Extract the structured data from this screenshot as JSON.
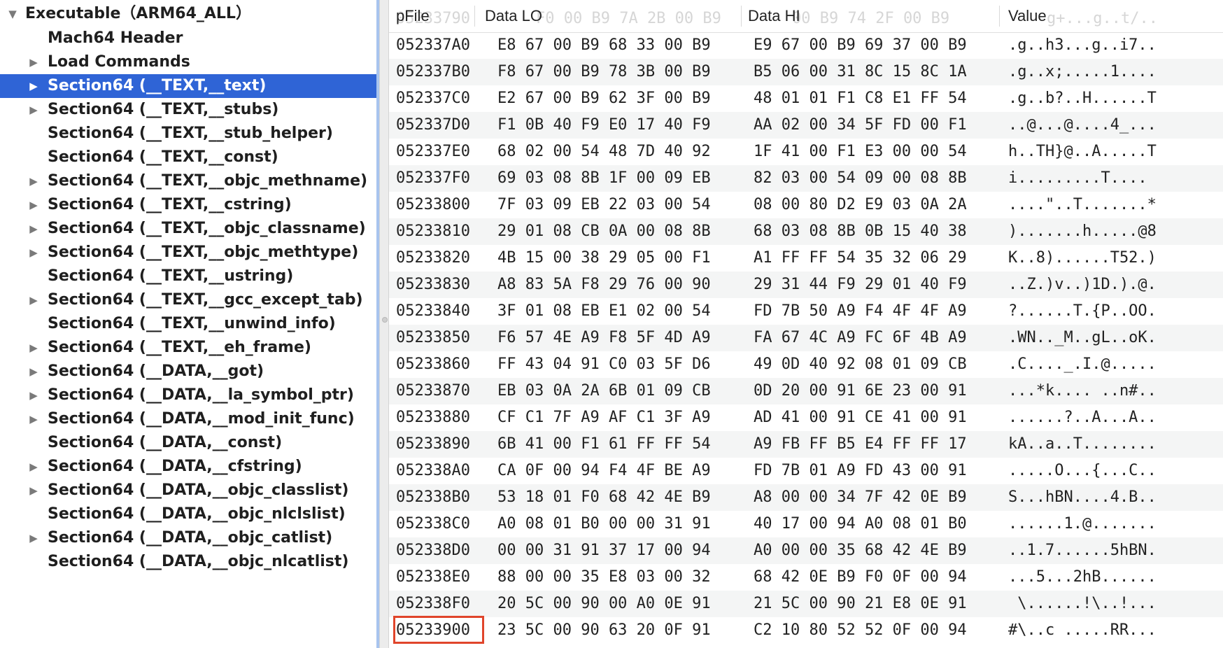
{
  "tree": {
    "root_label": "Executable（ARM64_ALL）",
    "items": [
      {
        "label": "Mach64 Header",
        "expandable": false,
        "selected": false
      },
      {
        "label": "Load Commands",
        "expandable": true,
        "selected": false
      },
      {
        "label": "Section64 (__TEXT,__text)",
        "expandable": true,
        "selected": true
      },
      {
        "label": "Section64 (__TEXT,__stubs)",
        "expandable": true,
        "selected": false
      },
      {
        "label": "Section64 (__TEXT,__stub_helper)",
        "expandable": false,
        "selected": false
      },
      {
        "label": "Section64 (__TEXT,__const)",
        "expandable": false,
        "selected": false
      },
      {
        "label": "Section64 (__TEXT,__objc_methname)",
        "expandable": true,
        "selected": false
      },
      {
        "label": "Section64 (__TEXT,__cstring)",
        "expandable": true,
        "selected": false
      },
      {
        "label": "Section64 (__TEXT,__objc_classname)",
        "expandable": true,
        "selected": false
      },
      {
        "label": "Section64 (__TEXT,__objc_methtype)",
        "expandable": true,
        "selected": false
      },
      {
        "label": "Section64 (__TEXT,__ustring)",
        "expandable": false,
        "selected": false
      },
      {
        "label": "Section64 (__TEXT,__gcc_except_tab)",
        "expandable": true,
        "selected": false
      },
      {
        "label": "Section64 (__TEXT,__unwind_info)",
        "expandable": false,
        "selected": false
      },
      {
        "label": "Section64 (__TEXT,__eh_frame)",
        "expandable": true,
        "selected": false
      },
      {
        "label": "Section64 (__DATA,__got)",
        "expandable": true,
        "selected": false
      },
      {
        "label": "Section64 (__DATA,__la_symbol_ptr)",
        "expandable": true,
        "selected": false
      },
      {
        "label": "Section64 (__DATA,__mod_init_func)",
        "expandable": true,
        "selected": false
      },
      {
        "label": "Section64 (__DATA,__const)",
        "expandable": false,
        "selected": false
      },
      {
        "label": "Section64 (__DATA,__cfstring)",
        "expandable": true,
        "selected": false
      },
      {
        "label": "Section64 (__DATA,__objc_classlist)",
        "expandable": true,
        "selected": false
      },
      {
        "label": "Section64 (__DATA,__objc_nlclslist)",
        "expandable": false,
        "selected": false
      },
      {
        "label": "Section64 (__DATA,__objc_catlist)",
        "expandable": true,
        "selected": false
      },
      {
        "label": "Section64 (__DATA,__objc_nlcatlist)",
        "expandable": false,
        "selected": false
      }
    ]
  },
  "table": {
    "headers": [
      "pFile",
      "Data LO",
      "Data HI",
      "Value"
    ],
    "ghost_row": {
      "offset": "05233790",
      "lo": "F0 00 B9 7A 2B 00 B9",
      "hi": "00 B9 74 2F 00 B9",
      "value": "g+...g..t/.."
    },
    "rows": [
      {
        "offset": "052337A0",
        "lo": "E8 67 00 B9 68 33 00 B9",
        "hi": "E9 67 00 B9 69 37 00 B9",
        "value": ".g..h3...g..i7.."
      },
      {
        "offset": "052337B0",
        "lo": "F8 67 00 B9 78 3B 00 B9",
        "hi": "B5 06 00 31 8C 15 8C 1A",
        "value": ".g..x;.....1...."
      },
      {
        "offset": "052337C0",
        "lo": "E2 67 00 B9 62 3F 00 B9",
        "hi": "48 01 01 F1 C8 E1 FF 54",
        "value": ".g..b?..H......T"
      },
      {
        "offset": "052337D0",
        "lo": "F1 0B 40 F9 E0 17 40 F9",
        "hi": "AA 02 00 34 5F FD 00 F1",
        "value": "..@...@....4_..."
      },
      {
        "offset": "052337E0",
        "lo": "68 02 00 54 48 7D 40 92",
        "hi": "1F 41 00 F1 E3 00 00 54",
        "value": "h..TH}@..A.....T"
      },
      {
        "offset": "052337F0",
        "lo": "69 03 08 8B 1F 00 09 EB",
        "hi": "82 03 00 54 09 00 08 8B",
        "value": "i.........T...."
      },
      {
        "offset": "05233800",
        "lo": "7F 03 09 EB 22 03 00 54",
        "hi": "08 00 80 D2 E9 03 0A 2A",
        "value": "....\"..T.......*"
      },
      {
        "offset": "05233810",
        "lo": "29 01 08 CB 0A 00 08 8B",
        "hi": "68 03 08 8B 0B 15 40 38",
        "value": ").......h.....@8"
      },
      {
        "offset": "05233820",
        "lo": "4B 15 00 38 29 05 00 F1",
        "hi": "A1 FF FF 54 35 32 06 29",
        "value": "K..8)......T52.)"
      },
      {
        "offset": "05233830",
        "lo": "A8 83 5A F8 29 76 00 90",
        "hi": "29 31 44 F9 29 01 40 F9",
        "value": "..Z.)v..)1D.).@."
      },
      {
        "offset": "05233840",
        "lo": "3F 01 08 EB E1 02 00 54",
        "hi": "FD 7B 50 A9 F4 4F 4F A9",
        "value": "?......T.{P..OO."
      },
      {
        "offset": "05233850",
        "lo": "F6 57 4E A9 F8 5F 4D A9",
        "hi": "FA 67 4C A9 FC 6F 4B A9",
        "value": ".WN.._M..gL..oK."
      },
      {
        "offset": "05233860",
        "lo": "FF 43 04 91 C0 03 5F D6",
        "hi": "49 0D 40 92 08 01 09 CB",
        "value": ".C...._.I.@....."
      },
      {
        "offset": "05233870",
        "lo": "EB 03 0A 2A 6B 01 09 CB",
        "hi": "0D 20 00 91 6E 23 00 91",
        "value": "...*k.... ..n#.."
      },
      {
        "offset": "05233880",
        "lo": "CF C1 7F A9 AF C1 3F A9",
        "hi": "AD 41 00 91 CE 41 00 91",
        "value": "......?..A...A.."
      },
      {
        "offset": "05233890",
        "lo": "6B 41 00 F1 61 FF FF 54",
        "hi": "A9 FB FF B5 E4 FF FF 17",
        "value": "kA..a..T........"
      },
      {
        "offset": "052338A0",
        "lo": "CA 0F 00 94 F4 4F BE A9",
        "hi": "FD 7B 01 A9 FD 43 00 91",
        "value": ".....O...{...C.."
      },
      {
        "offset": "052338B0",
        "lo": "53 18 01 F0 68 42 4E B9",
        "hi": "A8 00 00 34 7F 42 0E B9",
        "value": "S...hBN....4.B.."
      },
      {
        "offset": "052338C0",
        "lo": "A0 08 01 B0 00 00 31 91",
        "hi": "40 17 00 94 A0 08 01 B0",
        "value": "......1.@......."
      },
      {
        "offset": "052338D0",
        "lo": "00 00 31 91 37 17 00 94",
        "hi": "A0 00 00 35 68 42 4E B9",
        "value": "..1.7......5hBN."
      },
      {
        "offset": "052338E0",
        "lo": "88 00 00 35 E8 03 00 32",
        "hi": "68 42 0E B9 F0 0F 00 94",
        "value": "...5...2hB......"
      },
      {
        "offset": "052338F0",
        "lo": "20 5C 00 90 00 A0 0E 91",
        "hi": "21 5C 00 90 21 E8 0E 91",
        "value": " \\......!\\..!..."
      },
      {
        "offset": "05233900",
        "lo": "23 5C 00 90 63 20 0F 91",
        "hi": "C2 10 80 52 52 0F 00 94",
        "value": "#\\..c .....RR...",
        "highlighted": true
      }
    ]
  },
  "colors": {
    "selection": "#2f64d6",
    "highlight_border": "#e0452b",
    "zebra": "#f4f5f5"
  },
  "icons": {
    "expanded": "disclosure-expanded-icon",
    "collapsed": "disclosure-collapsed-icon"
  }
}
